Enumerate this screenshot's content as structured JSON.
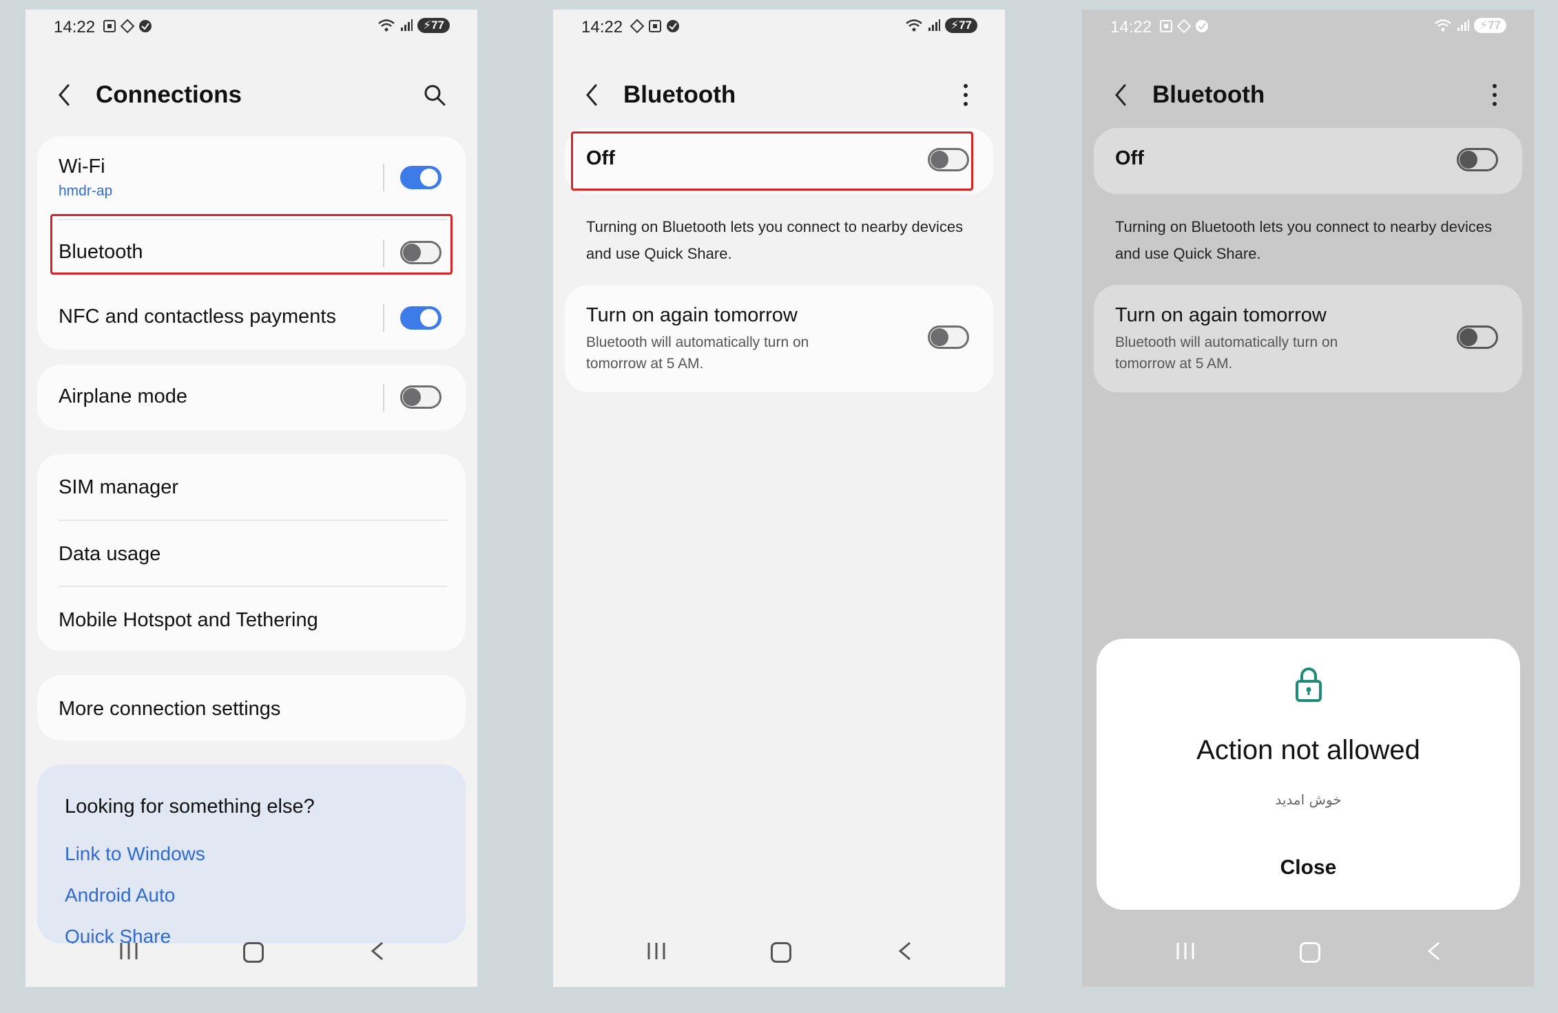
{
  "status": {
    "time": "14:22",
    "battery": "77"
  },
  "screen1": {
    "title": "Connections",
    "wifi": {
      "label": "Wi-Fi",
      "network": "hmdr-ap"
    },
    "bluetooth": {
      "label": "Bluetooth"
    },
    "nfc": {
      "label": "NFC and contactless payments"
    },
    "airplane": {
      "label": "Airplane mode"
    },
    "sim": "SIM manager",
    "data_usage": "Data usage",
    "hotspot": "Mobile Hotspot and Tethering",
    "more": "More connection settings",
    "looking": {
      "title": "Looking for something else?",
      "links": [
        "Link to Windows",
        "Android Auto",
        "Quick Share"
      ]
    }
  },
  "screen2": {
    "title": "Bluetooth",
    "master": "Off",
    "info": "Turning on Bluetooth lets you connect to nearby devices and use Quick Share.",
    "tomorrow": {
      "title": "Turn on again tomorrow",
      "line1": "Bluetooth will automatically turn on",
      "line2": "tomorrow at 5 AM."
    }
  },
  "dialog": {
    "title": "Action not allowed",
    "message": "خوش امدید",
    "button": "Close"
  },
  "colors": {
    "accent": "#3d7ce8",
    "highlight": "#d92125",
    "link": "#2e6ad2",
    "lock": "#1e8a78"
  }
}
